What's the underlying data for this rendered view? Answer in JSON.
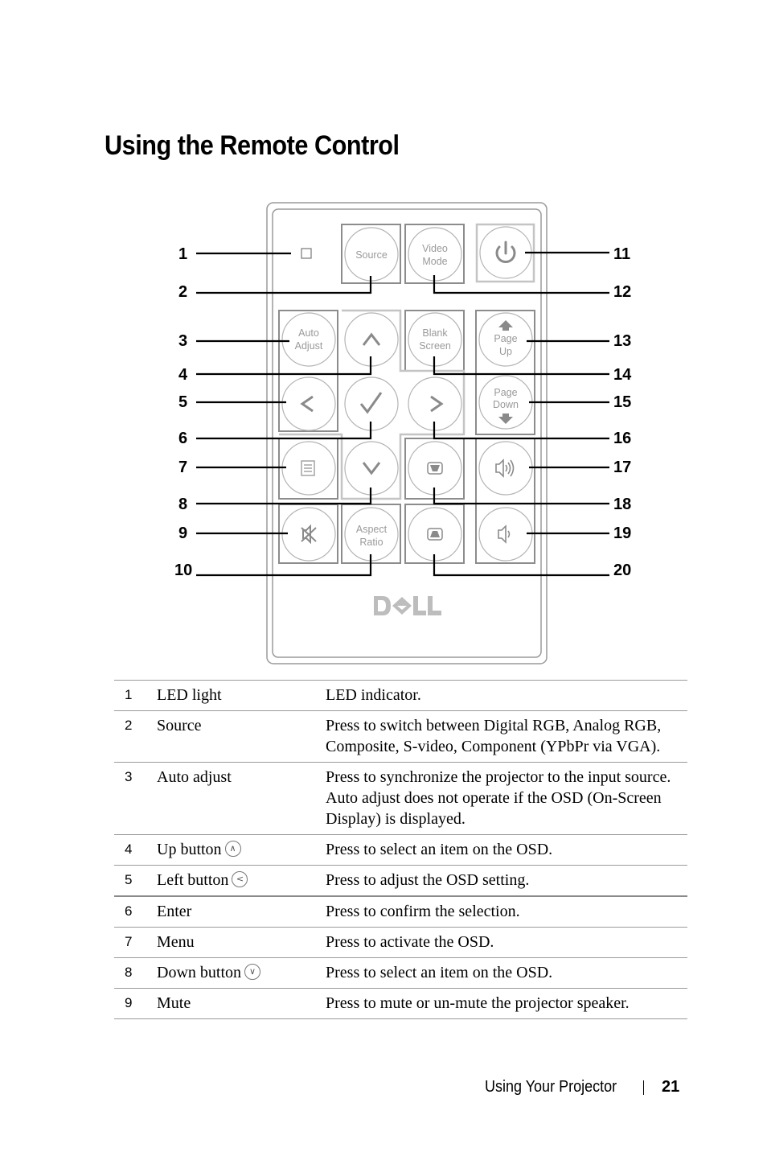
{
  "page": {
    "title": "Using the Remote Control",
    "footer": {
      "section": "Using Your Projector",
      "page_number": "21"
    }
  },
  "remote": {
    "logo": "DELL",
    "buttons": [
      {
        "id": "led",
        "label": "",
        "icon": "led-square-icon"
      },
      {
        "id": "source",
        "label": "Source",
        "icon": ""
      },
      {
        "id": "video-mode",
        "label": "Video\nMode",
        "lines": [
          "Video",
          "Mode"
        ],
        "icon": ""
      },
      {
        "id": "power",
        "label": "",
        "icon": "power-icon"
      },
      {
        "id": "auto-adjust",
        "lines": [
          "Auto",
          "Adjust"
        ],
        "icon": ""
      },
      {
        "id": "up",
        "icon": "chevron-up-icon"
      },
      {
        "id": "blank-screen",
        "lines": [
          "Blank",
          "Screen"
        ],
        "icon": ""
      },
      {
        "id": "page-up",
        "lines": [
          "Page",
          "Up"
        ],
        "icon": "arrow-up-icon"
      },
      {
        "id": "left",
        "icon": "chevron-left-icon"
      },
      {
        "id": "enter",
        "icon": "checkmark-icon"
      },
      {
        "id": "right",
        "icon": "chevron-right-icon"
      },
      {
        "id": "page-down",
        "lines": [
          "Page",
          "Down"
        ],
        "icon": "arrow-down-icon"
      },
      {
        "id": "menu",
        "icon": "menu-icon"
      },
      {
        "id": "down",
        "icon": "chevron-down-icon"
      },
      {
        "id": "keystone-up",
        "icon": "keystone-up-icon"
      },
      {
        "id": "volume-up",
        "icon": "volume-up-icon"
      },
      {
        "id": "mute",
        "icon": "mute-icon"
      },
      {
        "id": "aspect-ratio",
        "lines": [
          "Aspect",
          "Ratio"
        ],
        "icon": ""
      },
      {
        "id": "keystone-down",
        "icon": "keystone-down-icon"
      },
      {
        "id": "volume-down",
        "icon": "volume-down-icon"
      }
    ],
    "callouts_left": [
      "1",
      "2",
      "3",
      "4",
      "5",
      "6",
      "7",
      "8",
      "9",
      "10"
    ],
    "callouts_right": [
      "11",
      "12",
      "13",
      "14",
      "15",
      "16",
      "17",
      "18",
      "19",
      "20"
    ]
  },
  "table": {
    "rows": [
      {
        "num": "1",
        "name": "LED light",
        "icon": "",
        "desc": "LED indicator."
      },
      {
        "num": "2",
        "name": "Source",
        "icon": "",
        "desc": "Press to switch between Digital RGB, Analog RGB, Composite, S-video, Component (YPbPr via VGA)."
      },
      {
        "num": "3",
        "name": "Auto adjust",
        "icon": "",
        "desc": "Press to synchronize the projector to the input source. Auto adjust does not operate if the OSD (On-Screen Display) is displayed."
      },
      {
        "num": "4",
        "name": "Up button",
        "icon": "^",
        "desc": "Press to select an item on the OSD."
      },
      {
        "num": "5",
        "name": "Left button",
        "icon": "<",
        "desc": "Press to adjust the OSD setting."
      },
      {
        "num": "6",
        "name": "Enter",
        "icon": "",
        "desc": "Press to confirm the selection."
      },
      {
        "num": "7",
        "name": "Menu",
        "icon": "",
        "desc": "Press to activate the OSD."
      },
      {
        "num": "8",
        "name": "Down button",
        "icon": "v",
        "desc": "Press to select an item on the OSD."
      },
      {
        "num": "9",
        "name": "Mute",
        "icon": "",
        "desc": "Press to mute or un-mute the projector speaker."
      }
    ]
  }
}
